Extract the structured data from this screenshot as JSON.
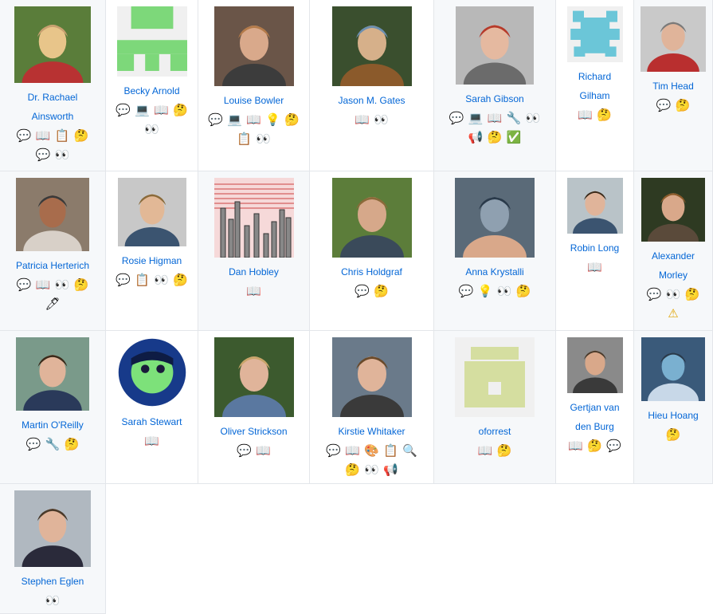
{
  "contributors": [
    {
      "name": "Dr. Rachael Ainsworth",
      "photo": "photo-woman-blonde-graduation",
      "contributions": [
        "comment",
        "doc",
        "content",
        "question",
        "comment",
        "eyes"
      ]
    },
    {
      "name": "Becky Arnold",
      "photo": "identicon-green",
      "contributions": [
        "comment",
        "laptop",
        "doc",
        "question",
        "eyes"
      ]
    },
    {
      "name": "Louise Bowler",
      "photo": "photo-woman-glasses",
      "contributions": [
        "comment",
        "laptop",
        "doc",
        "idea",
        "question",
        "content",
        "eyes"
      ]
    },
    {
      "name": "Jason M. Gates",
      "photo": "photo-man-cap-cartoon",
      "contributions": [
        "doc",
        "eyes"
      ]
    },
    {
      "name": "Sarah Gibson",
      "photo": "photo-woman-red-hair",
      "contributions": [
        "comment",
        "laptop",
        "doc",
        "wrench",
        "eyes",
        "megaphone",
        "question",
        "check"
      ]
    },
    {
      "name": "Richard Gilham",
      "photo": "identicon-blue",
      "contributions": [
        "doc",
        "question"
      ]
    },
    {
      "name": "Tim Head",
      "photo": "photo-man-red-jacket",
      "contributions": [
        "comment",
        "question"
      ]
    },
    {
      "name": "Patricia Herterich",
      "photo": "photo-woman-camera",
      "contributions": [
        "comment",
        "doc",
        "eyes",
        "question",
        "pencil"
      ]
    },
    {
      "name": "Rosie Higman",
      "photo": "photo-woman-short-hair",
      "contributions": [
        "comment",
        "content",
        "eyes",
        "question"
      ]
    },
    {
      "name": "Dan Hobley",
      "photo": "drawing-bars",
      "contributions": [
        "doc"
      ]
    },
    {
      "name": "Chris Holdgraf",
      "photo": "photo-man-smiling-outdoor",
      "contributions": [
        "comment",
        "question"
      ]
    },
    {
      "name": "Anna Krystalli",
      "photo": "photo-person-in-water",
      "contributions": [
        "comment",
        "idea",
        "eyes",
        "question"
      ]
    },
    {
      "name": "Robin Long",
      "photo": "photo-man-dark-hair",
      "contributions": [
        "doc"
      ]
    },
    {
      "name": "Alexander Morley",
      "photo": "photo-man-beard",
      "contributions": [
        "comment",
        "eyes",
        "question",
        "warning"
      ]
    },
    {
      "name": "Martin O'Reilly",
      "photo": "photo-man-suit",
      "contributions": [
        "comment",
        "wrench",
        "question"
      ]
    },
    {
      "name": "Sarah Stewart",
      "photo": "photo-woman-neon-circle",
      "contributions": [
        "doc"
      ]
    },
    {
      "name": "Oliver Strickson",
      "photo": "photo-man-blond-shirt",
      "contributions": [
        "comment",
        "doc"
      ]
    },
    {
      "name": "Kirstie Whitaker",
      "photo": "photo-woman-instagram",
      "contributions": [
        "comment",
        "doc",
        "design",
        "content",
        "search",
        "question",
        "eyes",
        "megaphone"
      ]
    },
    {
      "name": "oforrest",
      "photo": "identicon-olive",
      "contributions": [
        "doc",
        "question"
      ]
    },
    {
      "name": "Gertjan van den Burg",
      "photo": "photo-man-messy-hair",
      "contributions": [
        "doc",
        "question",
        "comment"
      ]
    },
    {
      "name": "Hieu Hoang",
      "photo": "photo-underwater-mask",
      "contributions": [
        "question"
      ]
    },
    {
      "name": "Stephen Eglen",
      "photo": "photo-man-glasses-suit",
      "contributions": [
        "eyes"
      ]
    }
  ],
  "icons": {
    "comment": "💬",
    "doc": "📖",
    "content": "📋",
    "question": "🤔",
    "eyes": "👀",
    "laptop": "💻",
    "idea": "💡",
    "wrench": "🔧",
    "megaphone": "📢",
    "check": "✅",
    "pencil": "🖊",
    "warning": "⚠",
    "design": "🎨",
    "search": "🔍"
  },
  "colors": {
    "link": "#0366d6",
    "green_identicon": "#7dd87a",
    "blue_identicon": "#6bc6d8",
    "olive_identicon": "#d5dea0"
  }
}
